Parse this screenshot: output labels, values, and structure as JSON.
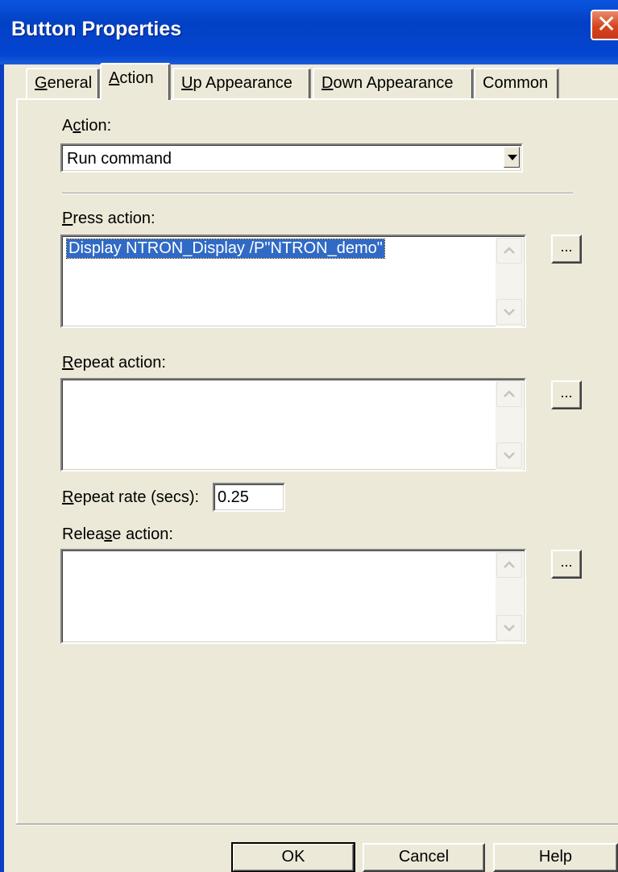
{
  "window": {
    "title": "Button Properties",
    "close_glyph": "✕"
  },
  "tabs": [
    {
      "pre": "",
      "mnemonic": "G",
      "post": "eneral",
      "active": false
    },
    {
      "pre": "",
      "mnemonic": "A",
      "post": "ction",
      "active": true
    },
    {
      "pre": "",
      "mnemonic": "U",
      "post": "p Appearance",
      "active": false
    },
    {
      "pre": "",
      "mnemonic": "D",
      "post": "own Appearance",
      "active": false
    },
    {
      "pre": "",
      "mnemonic": "",
      "post": "Common",
      "active": false
    }
  ],
  "action": {
    "label_pre": "A",
    "label_mnemonic": "c",
    "label_post": "tion:",
    "selected": "Run command"
  },
  "press_action": {
    "label_mnemonic": "P",
    "label_post": "ress action:",
    "value": "Display NTRON_Display /P\"NTRON_demo\"",
    "browse_label": "..."
  },
  "repeat_action": {
    "label_mnemonic": "R",
    "label_post": "epeat action:",
    "value": "",
    "browse_label": "..."
  },
  "repeat_rate": {
    "label_mnemonic": "R",
    "label_post": "epeat rate (secs):",
    "value": "0.25"
  },
  "release_action": {
    "label_pre": "Relea",
    "label_mnemonic": "s",
    "label_post": "e action:",
    "value": "",
    "browse_label": "..."
  },
  "buttons": {
    "ok": "OK",
    "cancel": "Cancel",
    "help": "Help"
  },
  "icons": {
    "close": "close-icon",
    "dropdown": "chevron-down-icon",
    "scroll_up": "chevron-up-icon",
    "scroll_down": "chevron-down-icon"
  }
}
